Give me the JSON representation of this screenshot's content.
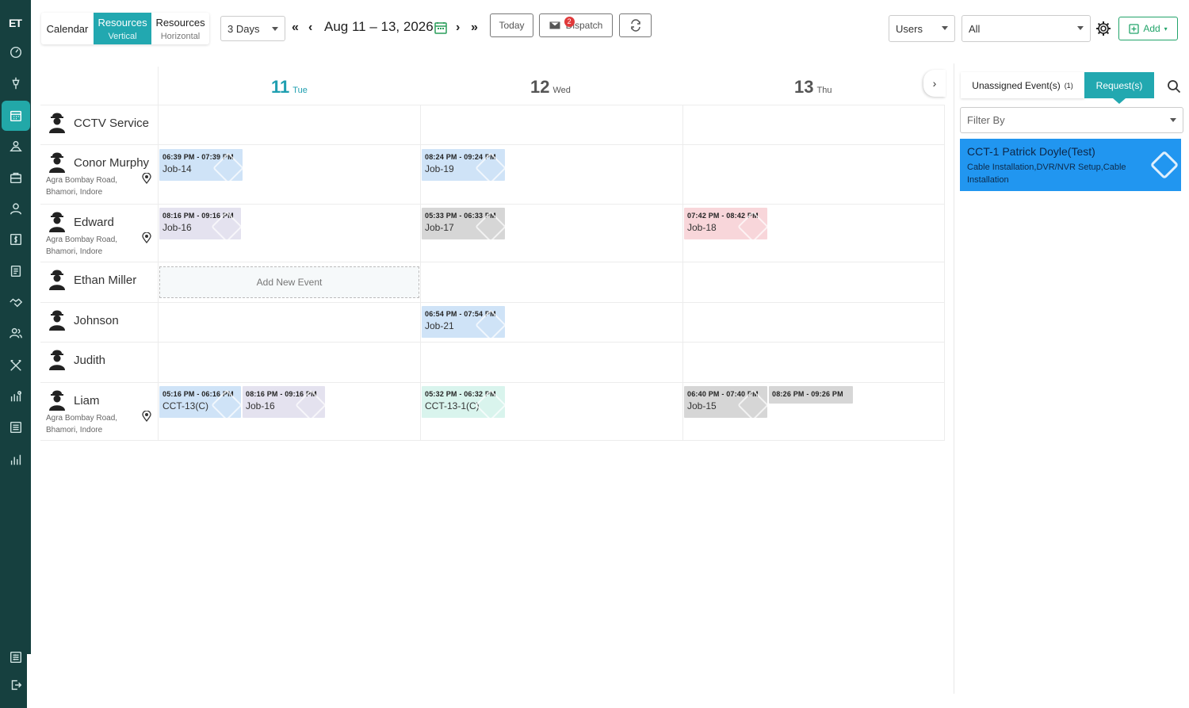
{
  "sidebar": {
    "logo": "ET",
    "items": [
      "dashboard-icon",
      "pin-tool-icon",
      "calendar-icon",
      "map-user-icon",
      "briefcase-icon",
      "user-icon",
      "dollar-icon",
      "document-icon",
      "handshake-icon",
      "team-icon",
      "tools-icon",
      "chart-hand-icon",
      "report-icon",
      "bar-chart-icon",
      "settings-sliders-icon",
      "logout-icon"
    ],
    "active": "calendar-icon"
  },
  "toolbar": {
    "calendar_label": "Calendar",
    "res_vertical_label": "Resources",
    "res_vertical_sub": "Vertical",
    "res_horizontal_label": "Resources",
    "res_horizontal_sub": "Horizontal",
    "range_select": "3 Days",
    "date_range": "Aug 11 – 13, 2026",
    "today_label": "Today",
    "dispatch_label": "Dispatch",
    "dispatch_badge": "2",
    "users_select": "Users",
    "all_select": "All",
    "add_label": "Add"
  },
  "days": [
    {
      "num": "11",
      "dow": "Tue"
    },
    {
      "num": "12",
      "dow": "Wed"
    },
    {
      "num": "13",
      "dow": "Thu"
    }
  ],
  "resources": [
    {
      "name": "CCTV Service",
      "address": ""
    },
    {
      "name": "Conor Murphy",
      "address": "Agra Bombay Road, Bhamori, Indore"
    },
    {
      "name": "Edward",
      "address": "Agra Bombay Road, Bhamori, Indore"
    },
    {
      "name": "Ethan Miller",
      "address": ""
    },
    {
      "name": "Johnson",
      "address": ""
    },
    {
      "name": "Judith",
      "address": ""
    },
    {
      "name": "Liam",
      "address": "Agra Bombay Road, Bhamori, Indore"
    }
  ],
  "events": [
    {
      "time": "06:39 PM - 07:39 PM",
      "title": "Job-14",
      "color": "#cfe3f7"
    },
    {
      "time": "08:24 PM - 09:24 PM",
      "title": "Job-19",
      "color": "#cfe3f7"
    },
    {
      "time": "08:16 PM - 09:16 PM",
      "title": "Job-16",
      "color": "#e4e2ef"
    },
    {
      "time": "05:33 PM - 06:33 PM",
      "title": "Job-17",
      "color": "#d6d6d6"
    },
    {
      "time": "07:42 PM - 08:42 PM",
      "title": "Job-18",
      "color": "#f8d6da"
    },
    {
      "time": "06:54 PM - 07:54 PM",
      "title": "Job-21",
      "color": "#cfe3f7"
    },
    {
      "time": "05:16 PM - 06:16 PM",
      "title": "CCT-13(C)",
      "color": "#cfe3f7"
    },
    {
      "time": "08:16 PM - 09:16 PM",
      "title": "Job-16",
      "color": "#e4e2ef"
    },
    {
      "time": "05:32 PM - 06:32 PM",
      "title": "CCT-13-1(C)",
      "color": "#d9f4ed"
    },
    {
      "time": "06:40 PM - 07:40 PM",
      "title": "Job-15",
      "color": "#d6d6d6"
    },
    {
      "time": "08:26 PM - 09:26 PM",
      "title": "",
      "color": "#d6d6d6"
    }
  ],
  "add_new_event": "Add New Event",
  "panel": {
    "tab_unassigned": "Unassigned Event(s)",
    "tab_unassigned_count": "(1)",
    "tab_requests": "Request(s)",
    "filter_placeholder": "Filter By",
    "request": {
      "title": "CCT-1 Patrick Doyle(Test)",
      "services": "Cable Installation,DVR/NVR Setup,Cable Installation",
      "color": "#2196f0"
    }
  },
  "colors": {
    "sidebar": "#16403f",
    "accent": "#22a8b0",
    "add_green": "#22a46a"
  }
}
